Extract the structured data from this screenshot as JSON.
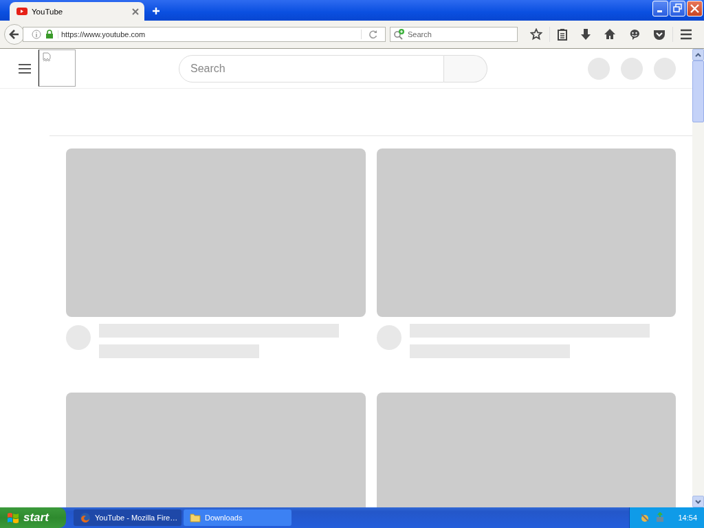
{
  "browser": {
    "tabs": [
      {
        "title": "YouTube",
        "selected": true
      }
    ],
    "url": "https://www.youtube.com",
    "search": {
      "placeholder": "Search"
    }
  },
  "page": {
    "search": {
      "placeholder": "Search"
    },
    "placeholders": [
      {
        "kind": "video"
      },
      {
        "kind": "video"
      },
      {
        "kind": "thumbnail"
      },
      {
        "kind": "thumbnail"
      }
    ]
  },
  "taskbar": {
    "start": "start",
    "items": [
      {
        "label": "YouTube - Mozilla Fire…",
        "kind": "browser",
        "selected": true
      },
      {
        "label": "Downloads",
        "kind": "folder",
        "selected": false
      }
    ],
    "clock": "14:54"
  }
}
